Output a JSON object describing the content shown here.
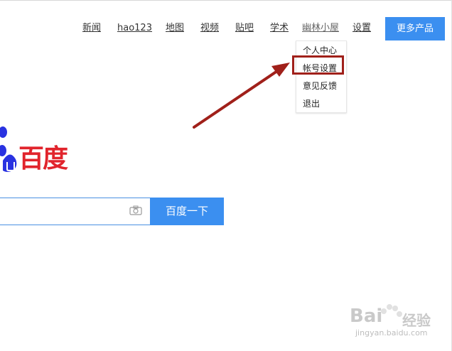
{
  "nav": {
    "links": [
      "新闻",
      "hao123",
      "地图",
      "视频",
      "贴吧",
      "学术"
    ],
    "user_name": "幽林小屋",
    "settings": "设置",
    "more_products": "更多产品"
  },
  "dropdown": {
    "items": [
      "个人中心",
      "帐号设置",
      "意见反馈",
      "退出"
    ]
  },
  "logo": {
    "text": "百度"
  },
  "search": {
    "value": "",
    "button_label": "百度一下"
  },
  "watermark": {
    "brand": "Bai",
    "cn": "经验",
    "url": "jingyan.baidu.com"
  },
  "colors": {
    "accent_blue": "#3b8ff0",
    "logo_red": "#e1242c",
    "logo_blue": "#2932e1",
    "annotation_red": "#a0201a"
  }
}
